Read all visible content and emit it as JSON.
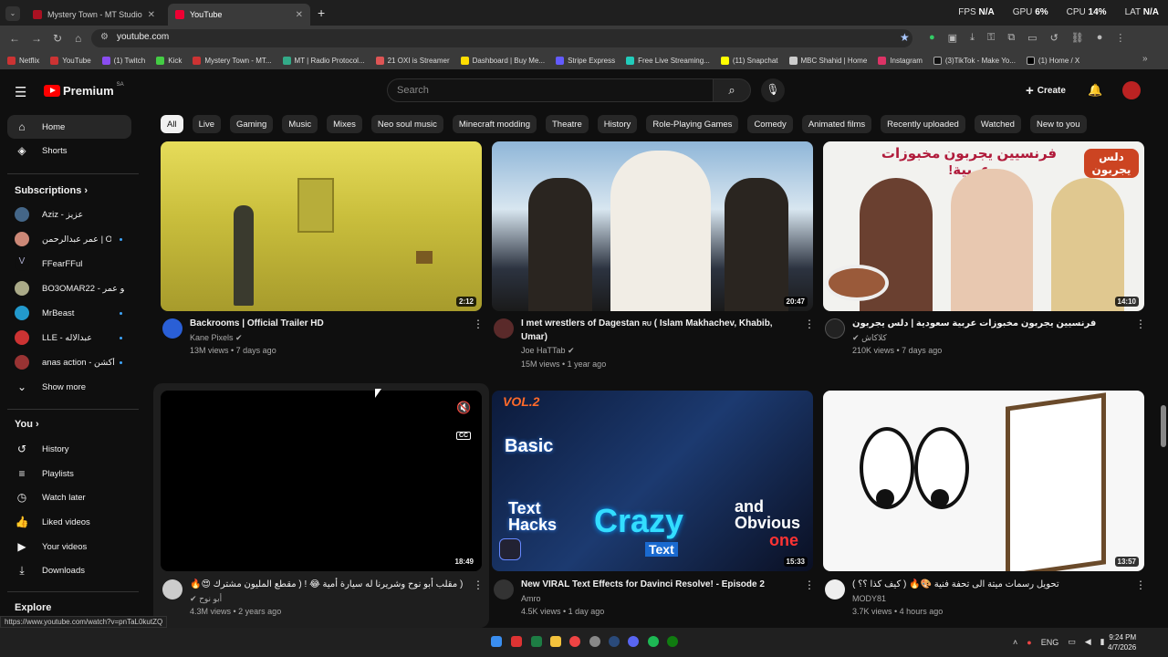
{
  "browser": {
    "tabs": [
      {
        "title": "Mystery Town - MT Studios | M",
        "active": false
      },
      {
        "title": "YouTube",
        "active": true
      }
    ],
    "sys": {
      "fps_label": "FPS",
      "fps_value": "N/A",
      "gpu_label": "GPU",
      "gpu_value": "6%",
      "cpu_label": "CPU",
      "cpu_value": "14%",
      "lat_label": "LAT",
      "lat_value": "N/A"
    },
    "url": "youtube.com",
    "bookmarks": [
      "Netflix",
      "YouTube",
      "(1) Twitch",
      "Kick",
      "Mystery Town - MT...",
      "MT | Radio Protocol...",
      "21 OXI is Streamer",
      "Dashboard | Buy Me...",
      "Stripe Express",
      "Free Live Streaming...",
      "(11) Snapchat",
      "MBC Shahid | Home",
      "Instagram",
      "(3)TikTok - Make Yo...",
      "(1) Home / X"
    ]
  },
  "header": {
    "logo": "Premium",
    "region": "SA",
    "search_placeholder": "Search",
    "create_label": "Create"
  },
  "chips": [
    "All",
    "Live",
    "Gaming",
    "Music",
    "Mixes",
    "Neo soul music",
    "Minecraft modding",
    "Theatre",
    "History",
    "Role-Playing Games",
    "Comedy",
    "Animated films",
    "Recently uploaded",
    "Watched",
    "New to you"
  ],
  "sidebar": {
    "home": "Home",
    "shorts": "Shorts",
    "subscriptions_title": "Subscriptions",
    "subs": [
      "Aziz - عزيز",
      "عمر عبدالرحمن | Om...",
      "FFearFFul",
      "BO3OMAR22 - أبو عمر",
      "MrBeast",
      "LLE - عبدالاله",
      "anas action - أنس أكشن"
    ],
    "show_more": "Show more",
    "you_title": "You",
    "you_items": [
      "History",
      "Playlists",
      "Watch later",
      "Liked videos",
      "Your videos",
      "Downloads"
    ],
    "explore": "Explore"
  },
  "videos": [
    {
      "title": "Backrooms | Official Trailer HD",
      "title2": "",
      "channel": "Kane Pixels",
      "meta": "13M views • 7 days ago",
      "duration": "2:12"
    },
    {
      "title": "I met wrestlers of Dagestan",
      "title_badge": "RU",
      "title2": "( Islam Makhachev, Khabib, Umar)",
      "channel": "Joe HaTTab",
      "meta": "15M views • 1 year ago",
      "duration": "20:47"
    },
    {
      "title": "فرنسيين يجربون مخبوزات عربية سعودية | دلس يجربون",
      "title2": "",
      "channel": "كلاكاش",
      "meta": "210K views • 7 days ago",
      "duration": "14:10"
    },
    {
      "title": "( مقلب أبو نوح وشريرنا له سيارة أمية 😂 ! ( مقطع المليون مشترك 😍🔥",
      "title2": "",
      "channel": "أبو نوح",
      "meta": "4.3M views • 2 years ago",
      "duration": "18:49"
    },
    {
      "title": "New VIRAL Text Effects for Davinci Resolve! - Episode 2",
      "title2": "",
      "channel": "Amro",
      "meta": "4.5K views • 1 day ago",
      "duration": "15:33"
    },
    {
      "title": "تحويل رسمات ميتة الى تحفة فنية 🎨🔥 ( كيف كذا ؟؟ )",
      "title2": "",
      "channel": "MODY81",
      "meta": "3.7K views • 4 hours ago",
      "duration": "13:57"
    }
  ],
  "thumb_text": {
    "arabic_banner": "فرنسيين يجربون مخبوزات عربية!",
    "brand_tag": "دلس يجربون",
    "vol": "VOL.2",
    "basic": "Basic",
    "text_hacks": "Text\nHacks",
    "crazy": "Crazy",
    "text_tag": "Text",
    "obvious": "and\nObvious",
    "one": "one",
    "cc": "CC"
  },
  "status_url": "https://www.youtube.com/watch?v=pnTaL0kutZQ",
  "clock": {
    "time": "9:24 PM",
    "date": "4/7/2026",
    "lang": "ENG"
  }
}
